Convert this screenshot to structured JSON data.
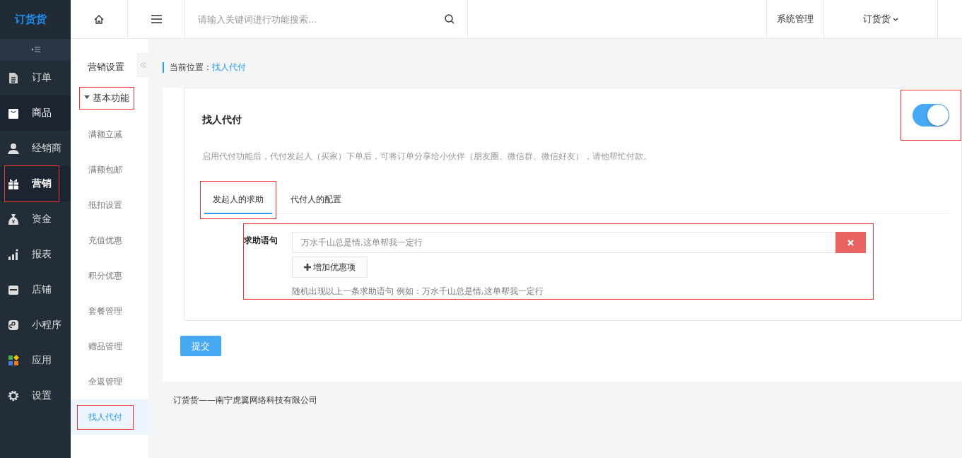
{
  "logo": "订货货",
  "sidebar": {
    "items": [
      {
        "label": "订单",
        "kind": "document",
        "selected": false,
        "hovered": false,
        "annotated": false
      },
      {
        "label": "商品",
        "kind": "bag",
        "selected": false,
        "hovered": true,
        "annotated": false
      },
      {
        "label": "经销商",
        "kind": "person",
        "selected": false,
        "hovered": false,
        "annotated": false
      },
      {
        "label": "营销",
        "kind": "gift",
        "selected": true,
        "hovered": false,
        "annotated": true
      },
      {
        "label": "资金",
        "kind": "moneybag",
        "selected": false,
        "hovered": false,
        "annotated": false
      },
      {
        "label": "报表",
        "kind": "chart",
        "selected": false,
        "hovered": false,
        "annotated": false
      },
      {
        "label": "店铺",
        "kind": "store",
        "selected": false,
        "hovered": false,
        "annotated": false
      },
      {
        "label": "小程序",
        "kind": "miniapp",
        "selected": false,
        "hovered": false,
        "annotated": false
      },
      {
        "label": "应用",
        "kind": "apps",
        "selected": false,
        "hovered": false,
        "annotated": false
      },
      {
        "label": "设置",
        "kind": "gear",
        "selected": false,
        "hovered": false,
        "annotated": false
      }
    ]
  },
  "topbar": {
    "search": {
      "placeholder": "请输入关键词进行功能搜索..."
    },
    "links": [
      {
        "label": "系统管理",
        "dropdown": false
      },
      {
        "label": "订货货",
        "dropdown": true
      }
    ]
  },
  "submenu": {
    "title": "营销设置",
    "groups": [
      {
        "label": "基本功能",
        "expanded": true,
        "annotated": true,
        "items": [
          {
            "label": "满额立减",
            "selected": false,
            "annotated": false
          },
          {
            "label": "满额包邮",
            "selected": false,
            "annotated": false
          },
          {
            "label": "抵扣设置",
            "selected": false,
            "annotated": false
          },
          {
            "label": "充值优惠",
            "selected": false,
            "annotated": false
          },
          {
            "label": "积分优惠",
            "selected": false,
            "annotated": false
          },
          {
            "label": "套餐管理",
            "selected": false,
            "annotated": false
          },
          {
            "label": "赠品管理",
            "selected": false,
            "annotated": false
          },
          {
            "label": "全返管理",
            "selected": false,
            "annotated": false
          },
          {
            "label": "找人代付",
            "selected": true,
            "annotated": true
          }
        ]
      }
    ]
  },
  "breadcrumb": {
    "label": "当前位置：",
    "current": "找人代付"
  },
  "card": {
    "title": "找人代付",
    "description": "启用代付功能后，代付发起人（买家）下单后，可将订单分享给小伙伴（朋友圈、微信群、微信好友），请他帮忙付款。",
    "enabled": true,
    "toggle_annotated": true,
    "tabs": [
      {
        "label": "发起人的求助",
        "selected": true,
        "annotated": true
      },
      {
        "label": "代付人的配置",
        "selected": false,
        "annotated": false
      }
    ],
    "form": {
      "label": "求助语句",
      "annotated": true,
      "phrases": [
        {
          "value": "万水千山总是情,这单帮我一定行"
        }
      ],
      "add_button": "增加优惠项",
      "help": "随机出现以上一条求助语句 例如：万水千山总是情,这单帮我一定行"
    }
  },
  "submit": "提交",
  "footer": "订货货——南宁虎翼网络科技有限公司"
}
